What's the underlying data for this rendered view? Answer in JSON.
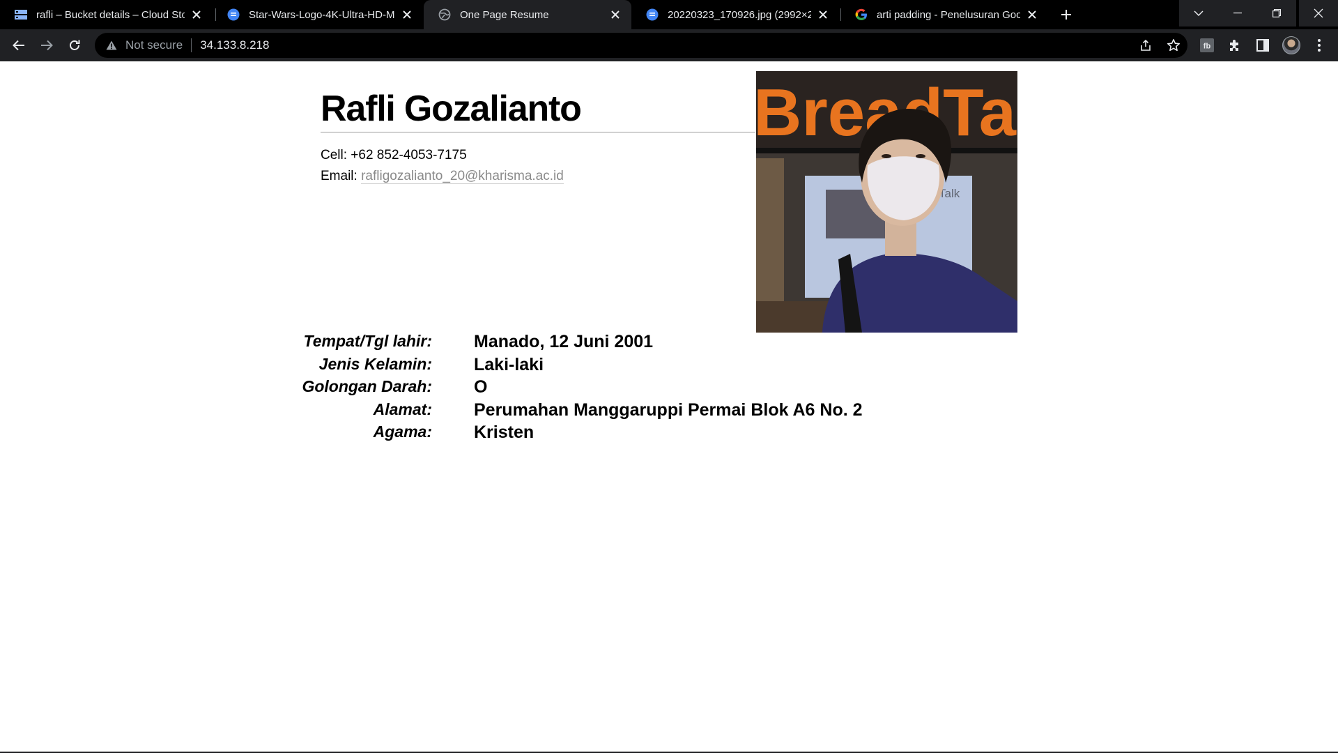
{
  "browser": {
    "tabs": [
      {
        "title": "rafli – Bucket details – Cloud Stor",
        "icon": "cloud-storage-icon",
        "active": false
      },
      {
        "title": "Star-Wars-Logo-4K-Ultra-HD-Mo",
        "icon": "file-icon",
        "active": false
      },
      {
        "title": "One Page Resume",
        "icon": "globe-icon",
        "active": true
      },
      {
        "title": "20220323_170926.jpg (2992×299",
        "icon": "file-icon",
        "active": false
      },
      {
        "title": "arti padding - Penelusuran Googl",
        "icon": "google-icon",
        "active": false
      }
    ],
    "address": {
      "security_label": "Not secure",
      "url": "34.133.8.218"
    }
  },
  "resume": {
    "name": "Rafli Gozalianto",
    "cell_label": "Cell:",
    "cell_value": "+62 852-4053-7175",
    "email_label": "Email:",
    "email_value": "rafligozalianto_20@kharisma.ac.id",
    "details": [
      {
        "label": "Tempat/Tgl lahir:",
        "value": "Manado, 12 Juni 2001"
      },
      {
        "label": "Jenis Kelamin:",
        "value": "Laki-laki"
      },
      {
        "label": "Golongan Darah:",
        "value": "O"
      },
      {
        "label": "Alamat:",
        "value": "Perumahan Manggaruppi Permai Blok A6 No. 2"
      },
      {
        "label": "Agama:",
        "value": "Kristen"
      }
    ],
    "photo_sign_text": "BreadTa",
    "photo_screen_text": "Talk"
  },
  "colors": {
    "tabstrip_bg": "#000000",
    "toolbar_bg": "#202124",
    "active_tab_bg": "#202124",
    "link_gray": "#8a8a8a",
    "sign_orange": "#e8741f",
    "shirt_navy": "#2f2f6a"
  }
}
